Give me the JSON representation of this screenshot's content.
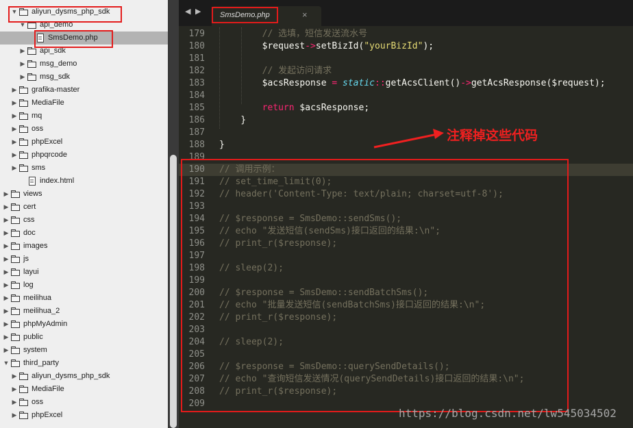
{
  "sidebar": {
    "rows": [
      {
        "label": "aliyun_dysms_php_sdk",
        "type": "folder",
        "open": true
      },
      {
        "label": "api_demo",
        "type": "folder",
        "open": true
      },
      {
        "label": "SmsDemo.php",
        "type": "file",
        "selected": true
      },
      {
        "label": "api_sdk",
        "type": "folder",
        "open": false
      },
      {
        "label": "msg_demo",
        "type": "folder",
        "open": false
      },
      {
        "label": "msg_sdk",
        "type": "folder",
        "open": false
      },
      {
        "label": "grafika-master",
        "type": "folder",
        "open": false
      },
      {
        "label": "MediaFile",
        "type": "folder",
        "open": false
      },
      {
        "label": "mq",
        "type": "folder",
        "open": false
      },
      {
        "label": "oss",
        "type": "folder",
        "open": false
      },
      {
        "label": "phpExcel",
        "type": "folder",
        "open": false
      },
      {
        "label": "phpqrcode",
        "type": "folder",
        "open": false
      },
      {
        "label": "sms",
        "type": "folder",
        "open": false
      },
      {
        "label": "index.html",
        "type": "file",
        "selected": false
      },
      {
        "label": "views",
        "type": "folder",
        "open": false
      },
      {
        "label": "cert",
        "type": "folder",
        "open": false
      },
      {
        "label": "css",
        "type": "folder",
        "open": false
      },
      {
        "label": "doc",
        "type": "folder",
        "open": false
      },
      {
        "label": "images",
        "type": "folder",
        "open": false
      },
      {
        "label": "js",
        "type": "folder",
        "open": false
      },
      {
        "label": "layui",
        "type": "folder",
        "open": false
      },
      {
        "label": "log",
        "type": "folder",
        "open": false
      },
      {
        "label": "meilihua",
        "type": "folder",
        "open": false
      },
      {
        "label": "meilihua_2",
        "type": "folder",
        "open": false
      },
      {
        "label": "phpMyAdmin",
        "type": "folder",
        "open": false
      },
      {
        "label": "public",
        "type": "folder",
        "open": false
      },
      {
        "label": "system",
        "type": "folder",
        "open": false
      },
      {
        "label": "third_party",
        "type": "folder",
        "open": true
      },
      {
        "label": "aliyun_dysms_php_sdk",
        "type": "folder",
        "open": false
      },
      {
        "label": "MediaFile",
        "type": "folder",
        "open": false
      },
      {
        "label": "oss",
        "type": "folder",
        "open": false
      },
      {
        "label": "phpExcel",
        "type": "folder",
        "open": false
      }
    ]
  },
  "editor": {
    "tab_label": "SmsDemo.php",
    "tab_close": "×",
    "nav_back": "◀",
    "nav_forward": "▶",
    "lines": [
      {
        "n": "179",
        "tokens": [
          {
            "t": "        // 选填，短信发送流水号",
            "c": "comment"
          }
        ]
      },
      {
        "n": "180",
        "tokens": [
          {
            "t": "        $request",
            "c": "var"
          },
          {
            "t": "->",
            "c": "op"
          },
          {
            "t": "setBizId(",
            "c": "fn"
          },
          {
            "t": "\"yourBizId\"",
            "c": "str"
          },
          {
            "t": ");",
            "c": "fn"
          }
        ]
      },
      {
        "n": "181",
        "tokens": []
      },
      {
        "n": "182",
        "tokens": [
          {
            "t": "        // 发起访问请求",
            "c": "comment"
          }
        ]
      },
      {
        "n": "183",
        "tokens": [
          {
            "t": "        $acsResponse ",
            "c": "var"
          },
          {
            "t": "=",
            "c": "op"
          },
          {
            "t": " ",
            "c": "var"
          },
          {
            "t": "static",
            "c": "static"
          },
          {
            "t": "::",
            "c": "op"
          },
          {
            "t": "getAcsClient()",
            "c": "fn"
          },
          {
            "t": "->",
            "c": "op"
          },
          {
            "t": "getAcsResponse($request);",
            "c": "fn"
          }
        ]
      },
      {
        "n": "184",
        "tokens": []
      },
      {
        "n": "185",
        "tokens": [
          {
            "t": "        ",
            "c": "var"
          },
          {
            "t": "return",
            "c": "kw"
          },
          {
            "t": " $acsResponse;",
            "c": "var"
          }
        ]
      },
      {
        "n": "186",
        "tokens": [
          {
            "t": "    }",
            "c": "var"
          }
        ]
      },
      {
        "n": "187",
        "tokens": []
      },
      {
        "n": "188",
        "tokens": [
          {
            "t": "}",
            "c": "var"
          }
        ]
      },
      {
        "n": "189",
        "tokens": []
      },
      {
        "n": "190",
        "tokens": [
          {
            "t": "// 调用示例：",
            "c": "comment"
          }
        ],
        "highlight": true
      },
      {
        "n": "191",
        "tokens": [
          {
            "t": "// set_time_limit(0);",
            "c": "comment"
          }
        ]
      },
      {
        "n": "192",
        "tokens": [
          {
            "t": "// header('Content-Type: text/plain; charset=utf-8');",
            "c": "comment"
          }
        ]
      },
      {
        "n": "193",
        "tokens": []
      },
      {
        "n": "194",
        "tokens": [
          {
            "t": "// $response = SmsDemo::sendSms();",
            "c": "comment"
          }
        ]
      },
      {
        "n": "195",
        "tokens": [
          {
            "t": "// echo \"发送短信(sendSms)接口返回的结果:\\n\";",
            "c": "comment"
          }
        ]
      },
      {
        "n": "196",
        "tokens": [
          {
            "t": "// print_r($response);",
            "c": "comment"
          }
        ]
      },
      {
        "n": "197",
        "tokens": []
      },
      {
        "n": "198",
        "tokens": [
          {
            "t": "// sleep(2);",
            "c": "comment"
          }
        ]
      },
      {
        "n": "199",
        "tokens": []
      },
      {
        "n": "200",
        "tokens": [
          {
            "t": "// $response = SmsDemo::sendBatchSms();",
            "c": "comment"
          }
        ]
      },
      {
        "n": "201",
        "tokens": [
          {
            "t": "// echo \"批量发送短信(sendBatchSms)接口返回的结果:\\n\";",
            "c": "comment"
          }
        ]
      },
      {
        "n": "202",
        "tokens": [
          {
            "t": "// print_r($response);",
            "c": "comment"
          }
        ]
      },
      {
        "n": "203",
        "tokens": []
      },
      {
        "n": "204",
        "tokens": [
          {
            "t": "// sleep(2);",
            "c": "comment"
          }
        ]
      },
      {
        "n": "205",
        "tokens": []
      },
      {
        "n": "206",
        "tokens": [
          {
            "t": "// $response = SmsDemo::querySendDetails();",
            "c": "comment"
          }
        ]
      },
      {
        "n": "207",
        "tokens": [
          {
            "t": "// echo \"查询短信发送情况(querySendDetails)接口返回的结果:\\n\";",
            "c": "comment"
          }
        ]
      },
      {
        "n": "208",
        "tokens": [
          {
            "t": "// print_r($response);",
            "c": "comment"
          }
        ]
      },
      {
        "n": "209",
        "tokens": []
      }
    ]
  },
  "annotation": {
    "text": "注释掉这些代码",
    "color": "#ef2020"
  },
  "watermark": "https://blog.csdn.net/lw545034502",
  "colors": {
    "editor_bg": "#272822",
    "comment": "#75715e",
    "keyword": "#f92672",
    "string": "#e6db74",
    "static": "#66d9ef",
    "highlight_box": "#e31b1b"
  }
}
